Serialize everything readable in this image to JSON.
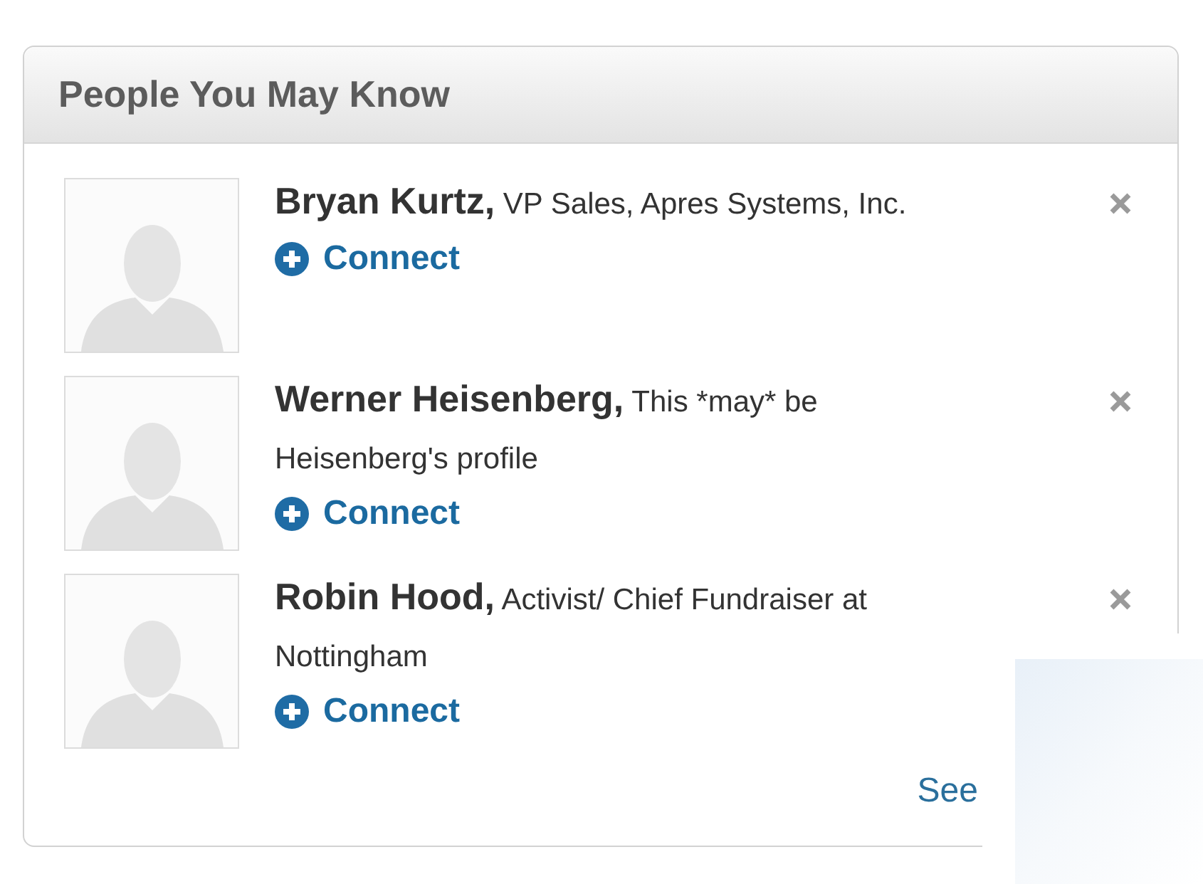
{
  "card": {
    "title": "People You May Know",
    "people": [
      {
        "name": "Bryan Kurtz,",
        "details": "VP Sales, Apres Systems, Inc.",
        "action": "Connect"
      },
      {
        "name": "Werner Heisenberg,",
        "details": "This *may* be Heisenberg's profile",
        "action": "Connect"
      },
      {
        "name": "Robin Hood,",
        "details": "Activist/ Chief Fundraiser at Nottingham",
        "action": "Connect"
      }
    ],
    "footer_link": "See"
  },
  "overlay": {
    "kind": "panel"
  }
}
